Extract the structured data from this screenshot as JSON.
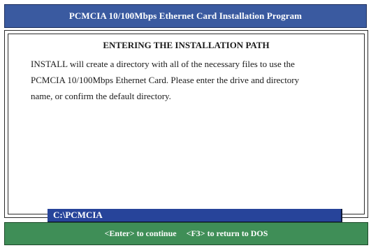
{
  "window": {
    "title": "PCMCIA 10/100Mbps Ethernet Card Installation Program"
  },
  "dialog": {
    "heading": "ENTERING THE INSTALLATION PATH",
    "lines": [
      "INSTALL will create a directory with all of the necessary files to use the",
      "PCMCIA 10/100Mbps Ethernet Card.  Please enter the drive and directory",
      "name, or confirm the default directory."
    ],
    "path_value": "C:\\PCMCIA"
  },
  "status_bar": {
    "continue_label": "<Enter> to continue",
    "return_label": "<F3> to return to DOS"
  },
  "colors": {
    "title_bar": "#3a5aa0",
    "path_field": "#27449a",
    "status_bar": "#3f8e57"
  }
}
